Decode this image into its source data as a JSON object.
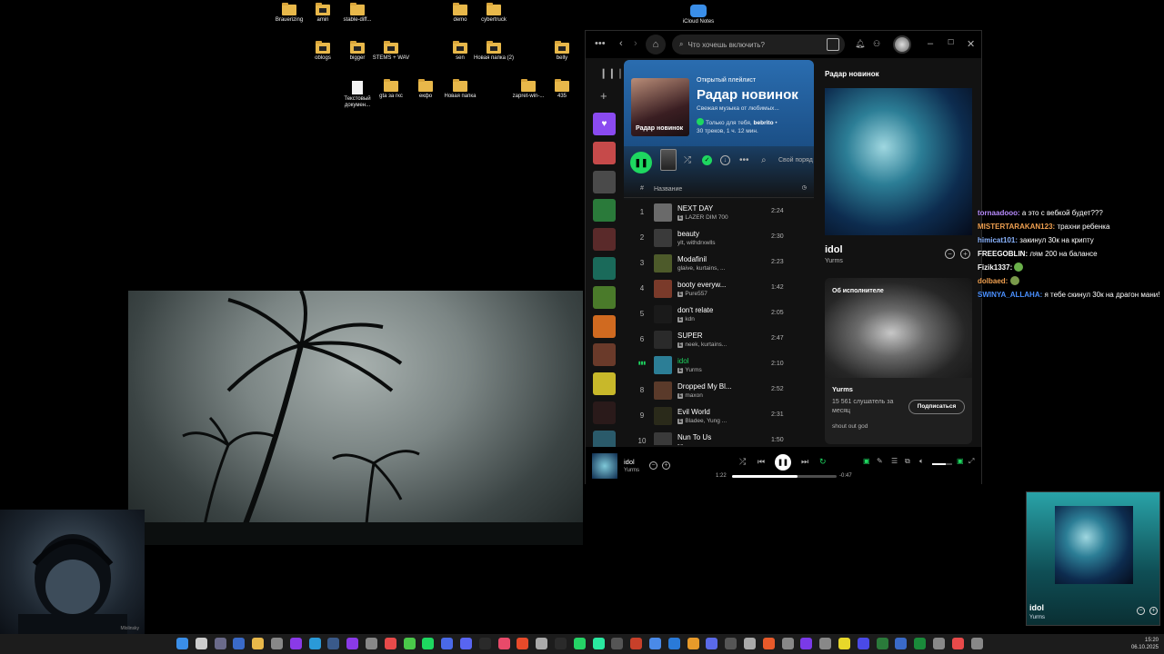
{
  "desktop": {
    "icons": [
      {
        "label": "Brauerizing",
        "type": "folder"
      },
      {
        "label": "amiri",
        "type": "folder-dark"
      },
      {
        "label": "stable-diff...",
        "type": "folder"
      },
      {
        "label": "demo",
        "type": "folder"
      },
      {
        "label": "cybertruck",
        "type": "folder"
      },
      {
        "label": "iCloud Notes",
        "type": "cloud"
      },
      {
        "label": "oblogs",
        "type": "folder-dark"
      },
      {
        "label": "bigger",
        "type": "folder-dark"
      },
      {
        "label": "STEMS + WAV",
        "type": "folder-dark"
      },
      {
        "label": "sen",
        "type": "folder-dark"
      },
      {
        "label": "Новая папка (2)",
        "type": "folder-dark"
      },
      {
        "label": "belly",
        "type": "folder-dark"
      },
      {
        "label": "Текстовый докумен...",
        "type": "doc"
      },
      {
        "label": "gta за гкс",
        "type": "folder"
      },
      {
        "label": "екфо",
        "type": "folder"
      },
      {
        "label": "Новая папка",
        "type": "folder"
      },
      {
        "label": "zapret-win-...",
        "type": "folder"
      },
      {
        "label": "435",
        "type": "folder"
      }
    ]
  },
  "webcam": {
    "tag": "Mlolinsky"
  },
  "spotify": {
    "search_placeholder": "Что хочешь включить?",
    "playlist": {
      "type_label": "Открытый плейлист",
      "title": "Радар новинок",
      "cover_caption": "Радар новинок",
      "description": "Свежая музыка от любимых...",
      "owner_prefix": "Только для тебя,",
      "owner_name": "bebrito",
      "stats": "30 треков, 1 ч. 12 мин."
    },
    "sort_label": "Свой поряд",
    "header": {
      "num": "#",
      "name": "Название"
    },
    "tracks": [
      {
        "index": "1",
        "title": "NEXT DAY",
        "artist": "LAZER DIM 700",
        "duration": "2:24",
        "explicit": true,
        "color": "#6a6a6a",
        "active": false
      },
      {
        "index": "2",
        "title": "beauty",
        "artist": "ylt, withdrxwlls",
        "duration": "2:30",
        "explicit": false,
        "color": "#3a3a3a",
        "active": false
      },
      {
        "index": "3",
        "title": "Modafinil",
        "artist": "glaive, kurtains, ...",
        "duration": "2:23",
        "explicit": false,
        "color": "#4d5a2a",
        "active": false
      },
      {
        "index": "4",
        "title": "booty everyw...",
        "artist": "Pure557",
        "duration": "1:42",
        "explicit": true,
        "color": "#7a3a2a",
        "active": false
      },
      {
        "index": "5",
        "title": "don't relate",
        "artist": "kdn",
        "duration": "2:05",
        "explicit": true,
        "color": "#1a1a1a",
        "active": false
      },
      {
        "index": "6",
        "title": "SUPER",
        "artist": "neek, kurtains...",
        "duration": "2:47",
        "explicit": true,
        "color": "#2a2a2a",
        "active": false
      },
      {
        "index": "",
        "title": "idol",
        "artist": "Yurms",
        "duration": "2:10",
        "explicit": true,
        "color": "#2c7e96",
        "active": true
      },
      {
        "index": "8",
        "title": "Dropped My Bl...",
        "artist": "maxon",
        "duration": "2:52",
        "explicit": true,
        "color": "#5a3a2a",
        "active": false
      },
      {
        "index": "9",
        "title": "Evil World",
        "artist": "Bladee, Yung ...",
        "duration": "2:31",
        "explicit": true,
        "color": "#2a2a1a",
        "active": false
      },
      {
        "index": "10",
        "title": "Nun To Us",
        "artist": "",
        "duration": "1:50",
        "explicit": true,
        "color": "#3a3a3a",
        "active": false
      }
    ],
    "now_playing_panel": {
      "heading": "Радар новинок",
      "title": "idol",
      "artist": "Yurms",
      "about_label": "Об исполнителе",
      "about_name": "Yurms",
      "listeners": "15 561 слушатель за месяц",
      "subscribe": "Подписаться",
      "bio": "shout out god"
    },
    "player": {
      "song": "idol",
      "artist": "Yurms",
      "elapsed": "1:22",
      "remaining": "-0:47",
      "progress": 0.63,
      "volume": 0.7
    }
  },
  "chat": [
    {
      "user": "tornaadooo:",
      "text": "а это с вебкой будет???",
      "color": "#b98cff"
    },
    {
      "user": "MISTERTARAKAN123:",
      "text": "трахни ребенка",
      "color": "#f0a050"
    },
    {
      "user": "himicat101:",
      "text": "закинул 30к на крипту",
      "color": "#8ab4ff"
    },
    {
      "user": "FREEGOBLIN:",
      "text": "лям 200 на балансе",
      "color": "#ffffff"
    },
    {
      "user": "Fizik1337:",
      "text": "",
      "color": "#ffffff",
      "emote": true
    },
    {
      "user": "dolbaed:",
      "text": "",
      "color": "#f0a050",
      "emote": true
    },
    {
      "user": "SWINYA_ALLAHA:",
      "text": "я тебе скинул 30к на драгон мани!",
      "color": "#4a90ff"
    }
  ],
  "mini_player": {
    "title": "idol",
    "artist": "Yurms"
  },
  "clock": {
    "time": "15:20",
    "date": "06.10.2025"
  }
}
